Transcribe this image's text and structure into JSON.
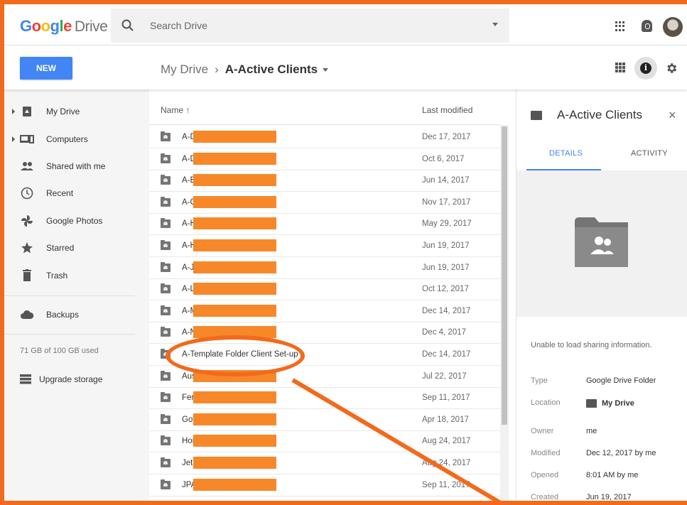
{
  "brand": {
    "google": [
      "G",
      "o",
      "o",
      "g",
      "l",
      "e"
    ],
    "google_colors": [
      "#4285f4",
      "#ea4335",
      "#fbbc05",
      "#4285f4",
      "#34a853",
      "#ea4335"
    ],
    "product": "Drive"
  },
  "search": {
    "placeholder": "Search Drive"
  },
  "toolbar": {
    "new_label": "NEW"
  },
  "breadcrumb": {
    "root": "My Drive",
    "separator": "›",
    "current": "A-Active Clients"
  },
  "sidebar": {
    "items": [
      {
        "label": "My Drive",
        "icon": "drive-icon",
        "expandable": true
      },
      {
        "label": "Computers",
        "icon": "computers-icon",
        "expandable": true
      },
      {
        "label": "Shared with me",
        "icon": "people-icon",
        "expandable": false
      },
      {
        "label": "Recent",
        "icon": "clock-icon",
        "expandable": false
      },
      {
        "label": "Google Photos",
        "icon": "pinwheel-icon",
        "expandable": false
      },
      {
        "label": "Starred",
        "icon": "star-icon",
        "expandable": false
      },
      {
        "label": "Trash",
        "icon": "trash-icon",
        "expandable": false
      }
    ],
    "backups": "Backups",
    "storage": "71 GB of 100 GB used",
    "upgrade": "Upgrade storage"
  },
  "list": {
    "col_name": "Name ↑",
    "col_modified": "Last modified",
    "rows": [
      {
        "name": "A-D",
        "modified": "Dec 17, 2017",
        "redacted": true
      },
      {
        "name": "A-D",
        "modified": "Oct 6, 2017",
        "redacted": true
      },
      {
        "name": "A-E",
        "modified": "Jun 14, 2017",
        "redacted": true
      },
      {
        "name": "A-G",
        "modified": "Nov 17, 2017",
        "redacted": true
      },
      {
        "name": "A-H",
        "modified": "May 29, 2017",
        "redacted": true
      },
      {
        "name": "A-H",
        "modified": "Jun 19, 2017",
        "redacted": true
      },
      {
        "name": "A-J",
        "modified": "Jun 19, 2017",
        "redacted": true
      },
      {
        "name": "A-L",
        "modified": "Oct 12, 2017",
        "redacted": true
      },
      {
        "name": "A-M",
        "modified": "Dec 14, 2017",
        "redacted": true
      },
      {
        "name": "A-N",
        "modified": "Dec 4, 2017",
        "redacted": true
      },
      {
        "name": "A-Template Folder Client Set-up",
        "modified": "Dec 14, 2017",
        "redacted": false
      },
      {
        "name": "Aus",
        "modified": "Jul 22, 2017",
        "redacted": true
      },
      {
        "name": "Ferr",
        "modified": "Sep 11, 2017",
        "redacted": true
      },
      {
        "name": "Goth",
        "modified": "Apr 18, 2017",
        "redacted": true
      },
      {
        "name": "Hor",
        "modified": "Aug 24, 2017",
        "redacted": true
      },
      {
        "name": "Jet",
        "modified": "Aug 24, 2017",
        "redacted": true
      },
      {
        "name": "JPA",
        "modified": "Sep 11, 2017",
        "redacted": true
      }
    ]
  },
  "details": {
    "title": "A-Active Clients",
    "close": "×",
    "tab_details": "DETAILS",
    "tab_activity": "ACTIVITY",
    "share_msg": "Unable to load sharing information.",
    "props": [
      {
        "k": "Type",
        "v": "Google Drive Folder"
      },
      {
        "k": "Location",
        "v": "My Drive"
      },
      {
        "k": "Owner",
        "v": "me"
      },
      {
        "k": "Modified",
        "v": "Dec 12, 2017 by me"
      },
      {
        "k": "Opened",
        "v": "8:01 AM by me"
      },
      {
        "k": "Created",
        "v": "Jun 19, 2017"
      }
    ]
  },
  "colors": {
    "accent": "#4285f4",
    "annotation": "#f26a1b",
    "redaction": "#f7882a"
  }
}
